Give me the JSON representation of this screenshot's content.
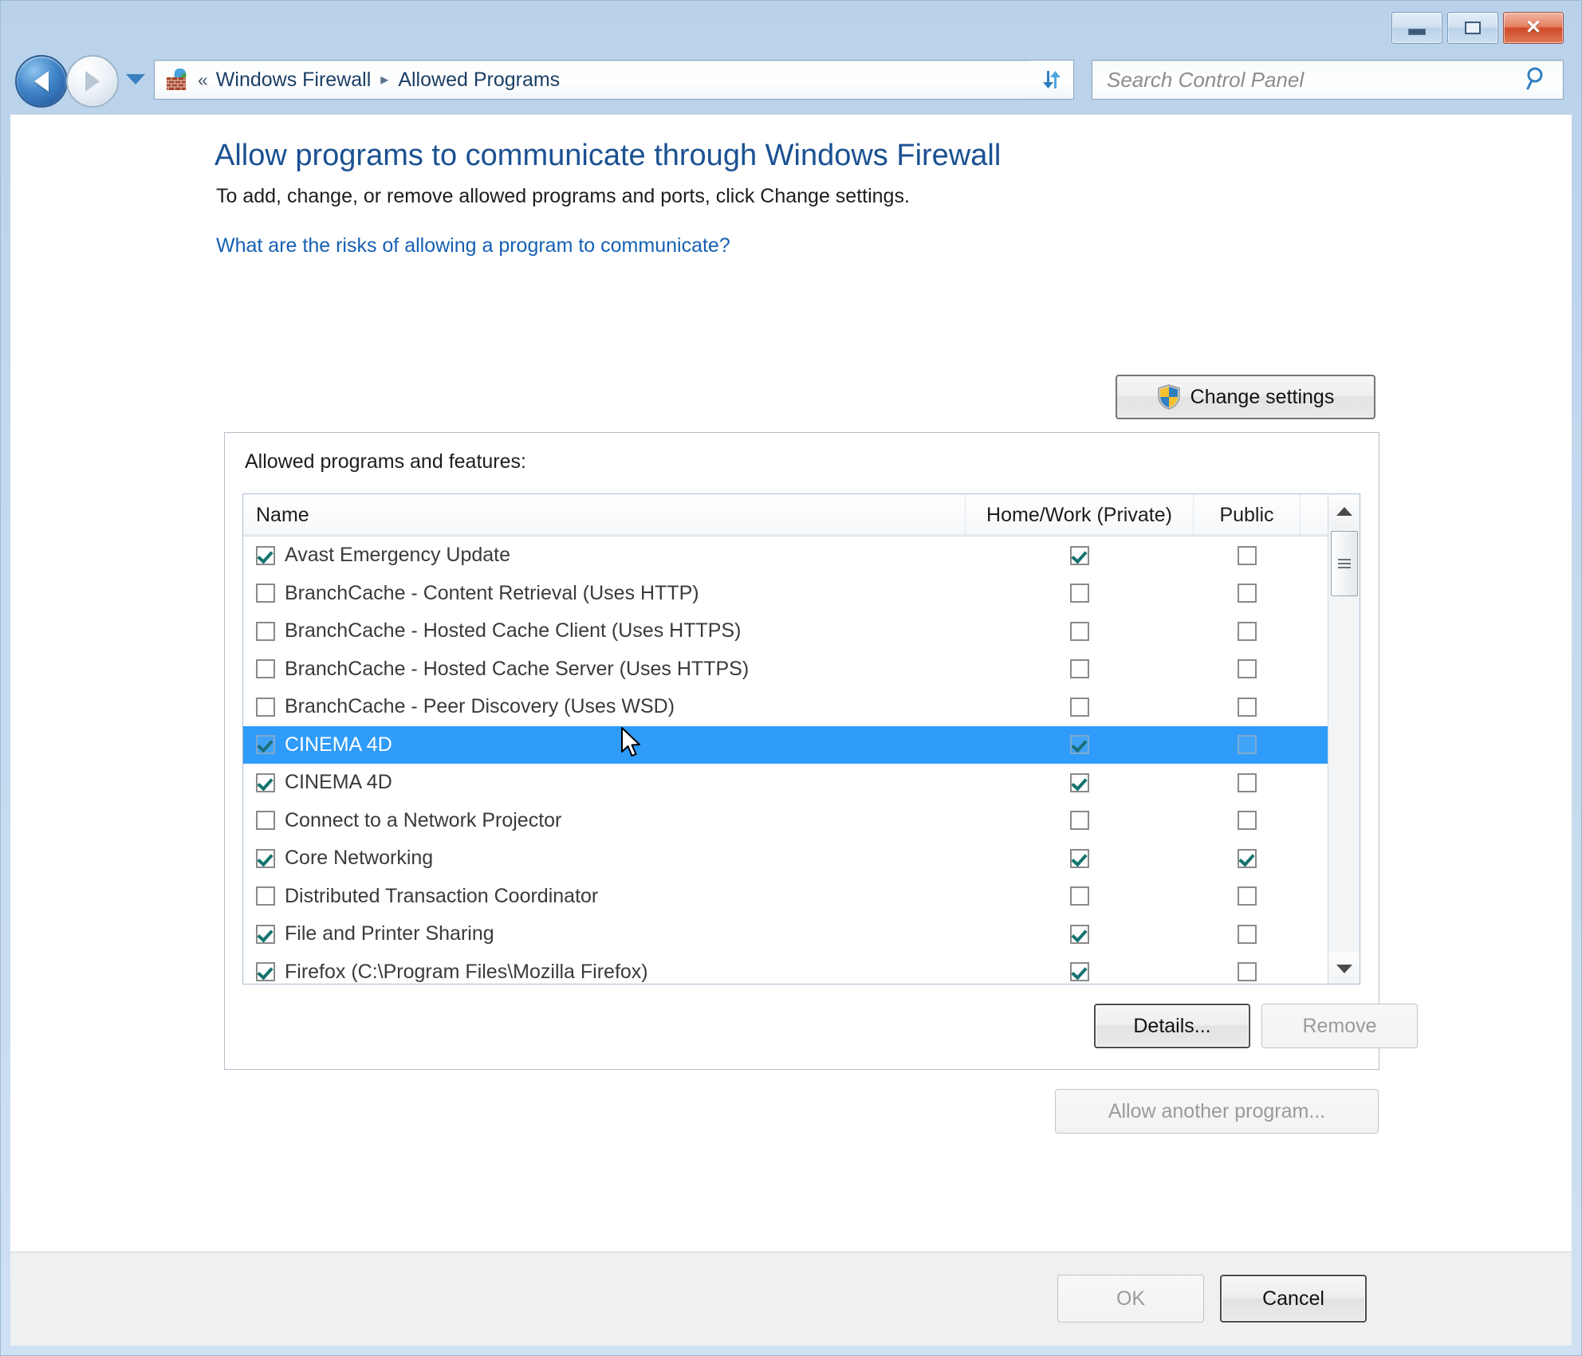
{
  "window": {
    "controls": {
      "minimize_label": "Minimize",
      "maximize_label": "Maximize",
      "close_label": "✕"
    }
  },
  "navbar": {
    "back_label": "Back",
    "forward_label": "Forward",
    "history_label": "Recent pages",
    "icon_name": "windows-firewall-icon",
    "breadcrumb_chevron": "«",
    "breadcrumb": [
      {
        "label": "Windows Firewall"
      },
      {
        "label": "Allowed Programs"
      }
    ],
    "breadcrumb_separator": "▸",
    "dropdown_label": "Previous locations",
    "refresh_label": "Refresh",
    "search": {
      "placeholder": "Search Control Panel",
      "value": ""
    }
  },
  "page": {
    "title": "Allow programs to communicate through Windows Firewall",
    "subtitle": "To add, change, or remove allowed programs and ports, click Change settings.",
    "risks_link": "What are the risks of allowing a program to communicate?",
    "change_settings_label": "Change settings"
  },
  "group": {
    "label": "Allowed programs and features:",
    "details_label": "Details...",
    "remove_label": "Remove",
    "details_enabled": true,
    "remove_enabled": false
  },
  "allow_another_label": "Allow another program...",
  "allow_another_enabled": false,
  "list": {
    "columns": [
      "Name",
      "Home/Work (Private)",
      "Public"
    ],
    "rows": [
      {
        "name": "Avast Emergency Update",
        "name_checked": true,
        "private": true,
        "public": false,
        "selected": false
      },
      {
        "name": "BranchCache - Content Retrieval (Uses HTTP)",
        "name_checked": false,
        "private": false,
        "public": false,
        "selected": false
      },
      {
        "name": "BranchCache - Hosted Cache Client (Uses HTTPS)",
        "name_checked": false,
        "private": false,
        "public": false,
        "selected": false
      },
      {
        "name": "BranchCache - Hosted Cache Server (Uses HTTPS)",
        "name_checked": false,
        "private": false,
        "public": false,
        "selected": false
      },
      {
        "name": "BranchCache - Peer Discovery (Uses WSD)",
        "name_checked": false,
        "private": false,
        "public": false,
        "selected": false
      },
      {
        "name": "CINEMA 4D",
        "name_checked": true,
        "private": true,
        "public": false,
        "selected": true
      },
      {
        "name": "CINEMA 4D",
        "name_checked": true,
        "private": true,
        "public": false,
        "selected": false
      },
      {
        "name": "Connect to a Network Projector",
        "name_checked": false,
        "private": false,
        "public": false,
        "selected": false
      },
      {
        "name": "Core Networking",
        "name_checked": true,
        "private": true,
        "public": true,
        "selected": false
      },
      {
        "name": "Distributed Transaction Coordinator",
        "name_checked": false,
        "private": false,
        "public": false,
        "selected": false
      },
      {
        "name": "File and Printer Sharing",
        "name_checked": true,
        "private": true,
        "public": false,
        "selected": false
      },
      {
        "name": "Firefox (C:\\Program Files\\Mozilla Firefox)",
        "name_checked": true,
        "private": true,
        "public": false,
        "selected": false
      }
    ],
    "scrollbar": {
      "up_label": "Scroll up",
      "down_label": "Scroll down",
      "thumb_label": "Scroll thumb"
    }
  },
  "footer": {
    "ok_label": "OK",
    "cancel_label": "Cancel",
    "ok_enabled": false,
    "cancel_enabled": true
  },
  "colors": {
    "accent_blue": "#2f9bfa",
    "title_blue": "#1a5192",
    "link_blue": "#1560b4",
    "check_teal": "#14736e",
    "close_red": "#cf4a28"
  }
}
